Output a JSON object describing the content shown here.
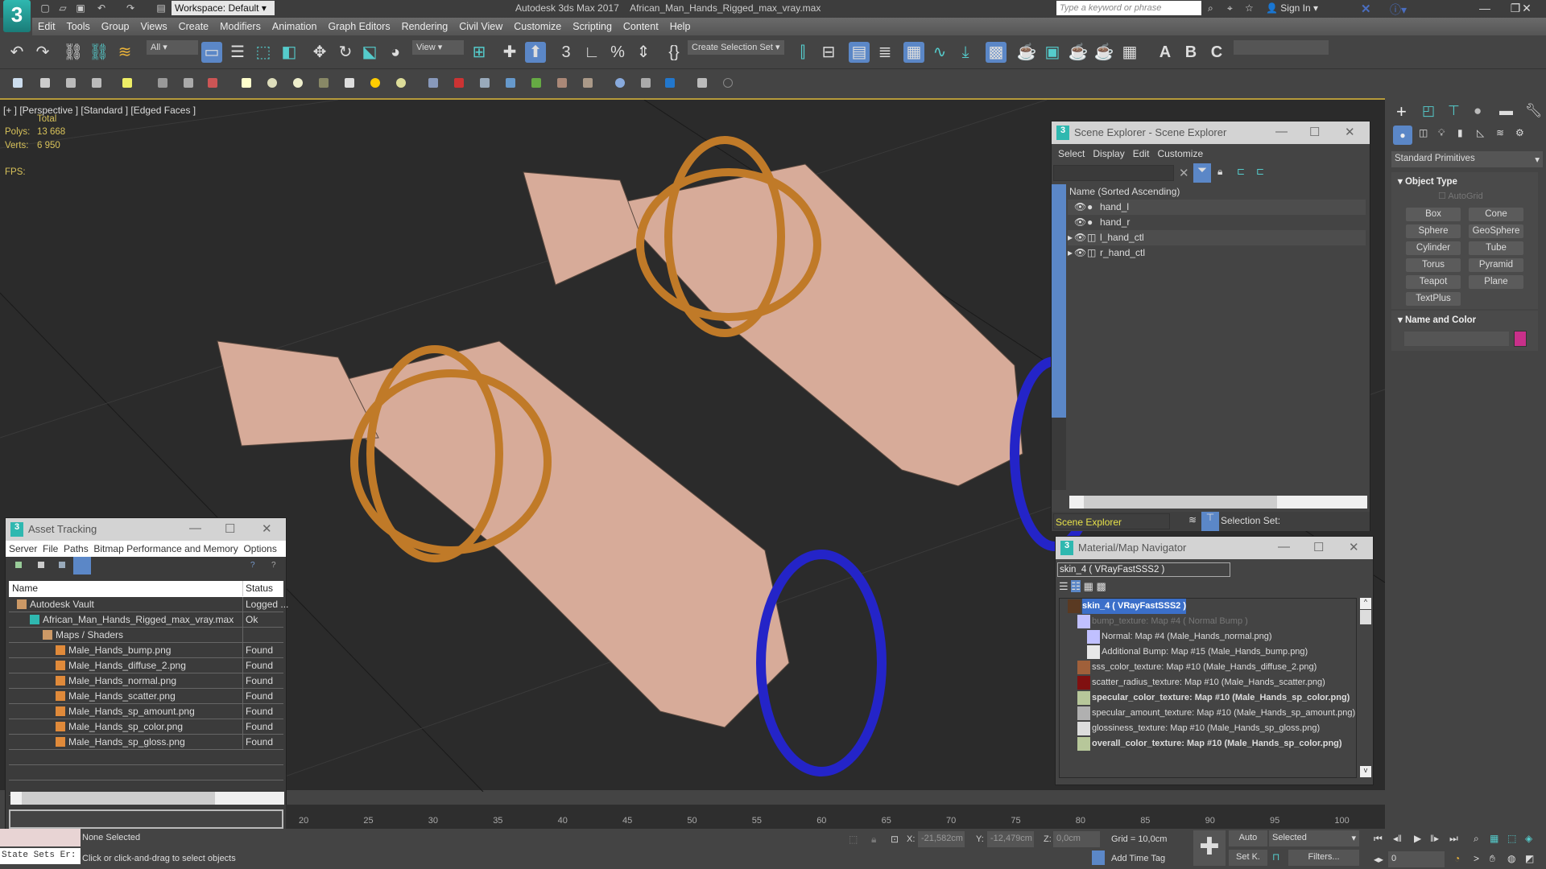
{
  "app": {
    "title": "Autodesk 3ds Max 2017",
    "file": "African_Man_Hands_Rigged_max_vray.max",
    "workspace": "Workspace: Default",
    "search_placeholder": "Type a keyword or phrase",
    "sign_in": "Sign In",
    "logo": "3"
  },
  "menu": [
    "Edit",
    "Tools",
    "Group",
    "Views",
    "Create",
    "Modifiers",
    "Animation",
    "Graph Editors",
    "Rendering",
    "Civil View",
    "Customize",
    "Scripting",
    "Content",
    "Help"
  ],
  "toolbar": {
    "filter": "All",
    "ref_coord": "View",
    "selection_set": "Create Selection Set"
  },
  "viewport": {
    "label": "[+ ] [Perspective ] [Standard ] [Edged Faces ]",
    "total": "Total",
    "polys_label": "Polys:",
    "polys": "13 668",
    "verts_label": "Verts:",
    "verts": "6 950",
    "fps_label": "FPS:"
  },
  "scene_explorer": {
    "title": "Scene Explorer - Scene Explorer",
    "menu": [
      "Select",
      "Display",
      "Edit",
      "Customize"
    ],
    "column": "Name (Sorted Ascending)",
    "items": [
      "hand_l",
      "hand_r",
      "l_hand_ctl",
      "r_hand_ctl"
    ],
    "footer_name": "Scene Explorer",
    "selection_set": "Selection Set:"
  },
  "material_navigator": {
    "title": "Material/Map Navigator",
    "field": "skin_4  ( VRayFastSSS2 )",
    "items": [
      {
        "text": "skin_4  ( VRayFastSSS2 )",
        "bold": true,
        "color": "#5a3a22"
      },
      {
        "text": "bump_texture: Map #4  ( Normal Bump )",
        "dim": true,
        "color": "#c0c0ff"
      },
      {
        "text": "Normal: Map #4 (Male_Hands_normal.png)",
        "color": "#c0c0ff"
      },
      {
        "text": "Additional Bump: Map #15 (Male_Hands_bump.png)",
        "color": "#e8e8e8"
      },
      {
        "text": "sss_color_texture: Map #10 (Male_Hands_diffuse_2.png)",
        "color": "#a0603a"
      },
      {
        "text": "scatter_radius_texture: Map #10 (Male_Hands_scatter.png)",
        "color": "#801010"
      },
      {
        "text": "specular_color_texture: Map #10 (Male_Hands_sp_color.png)",
        "bold": true,
        "color": "#b7c79a"
      },
      {
        "text": "specular_amount_texture: Map #10 (Male_Hands_sp_amount.png)",
        "color": "#b0b0b0"
      },
      {
        "text": "glossiness_texture: Map #10 (Male_Hands_sp_gloss.png)",
        "color": "#dcdcdc"
      },
      {
        "text": "overall_color_texture: Map #10 (Male_Hands_sp_color.png)",
        "bold": true,
        "color": "#b7c79a"
      }
    ]
  },
  "asset_tracking": {
    "title": "Asset Tracking",
    "menu": [
      "Server",
      "File",
      "Paths",
      "Bitmap Performance and Memory",
      "Options"
    ],
    "columns": [
      "Name",
      "Status"
    ],
    "rows": [
      {
        "name": "Autodesk Vault",
        "status": "Logged ...",
        "indent": 0
      },
      {
        "name": "African_Man_Hands_Rigged_max_vray.max",
        "status": "Ok",
        "indent": 1
      },
      {
        "name": "Maps / Shaders",
        "status": "",
        "indent": 2
      },
      {
        "name": "Male_Hands_bump.png",
        "status": "Found",
        "indent": 3
      },
      {
        "name": "Male_Hands_diffuse_2.png",
        "status": "Found",
        "indent": 3
      },
      {
        "name": "Male_Hands_normal.png",
        "status": "Found",
        "indent": 3
      },
      {
        "name": "Male_Hands_scatter.png",
        "status": "Found",
        "indent": 3
      },
      {
        "name": "Male_Hands_sp_amount.png",
        "status": "Found",
        "indent": 3
      },
      {
        "name": "Male_Hands_sp_color.png",
        "status": "Found",
        "indent": 3
      },
      {
        "name": "Male_Hands_sp_gloss.png",
        "status": "Found",
        "indent": 3
      }
    ]
  },
  "command_panel": {
    "category": "Standard Primitives",
    "rollout1": "Object Type",
    "autogrid": "AutoGrid",
    "buttons": [
      "Box",
      "Cone",
      "Sphere",
      "GeoSphere",
      "Cylinder",
      "Tube",
      "Torus",
      "Pyramid",
      "Teapot",
      "Plane",
      "TextPlus"
    ],
    "rollout2": "Name and Color",
    "color": "#c8308a"
  },
  "timeline": {
    "ticks": [
      "20",
      "25",
      "30",
      "35",
      "40",
      "45",
      "50",
      "55",
      "60",
      "65",
      "70",
      "75",
      "80",
      "85",
      "90",
      "95",
      "100"
    ]
  },
  "status": {
    "state_sets": "State Sets Er:",
    "selection": "None Selected",
    "prompt": "Click or click-and-drag to select objects",
    "x": "-21,582cm",
    "y": "-12,479cm",
    "z": "0,0cm",
    "grid": "Grid = 10,0cm",
    "add_time_tag": "Add Time Tag",
    "auto": "Auto",
    "set_key": "Set K.",
    "key_filter": "Selected",
    "filters": "Filters...",
    "frame": "0"
  }
}
